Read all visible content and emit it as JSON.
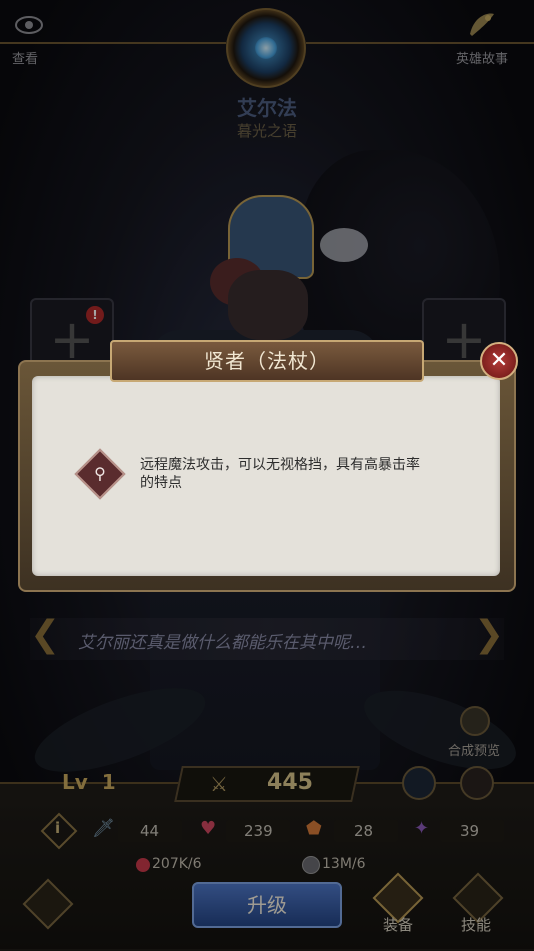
{
  "top": {
    "view_label": "查看",
    "story_label": "英雄故事"
  },
  "hero": {
    "name": "艾尔法",
    "title": "暮光之语"
  },
  "slots": {
    "alert": "!"
  },
  "dialog": {
    "title": "贤者（法杖）",
    "close": "✕",
    "description_line1": "远程魔法攻击，可以无视格挡，具有高暴击率",
    "description_line2": "的特点"
  },
  "quote": {
    "text": "艾尔丽还真是做什么都能乐在其中呢…"
  },
  "side": {
    "synth_preview": "合成预览"
  },
  "stats": {
    "level_prefix": "Lv",
    "level": "1",
    "power": "445",
    "attack": "44",
    "hp": "239",
    "defense": "28",
    "speed": "39",
    "gold": "207K/6",
    "stone": "13M/6"
  },
  "buttons": {
    "upgrade": "升级",
    "equip": "装备",
    "skill": "技能"
  }
}
